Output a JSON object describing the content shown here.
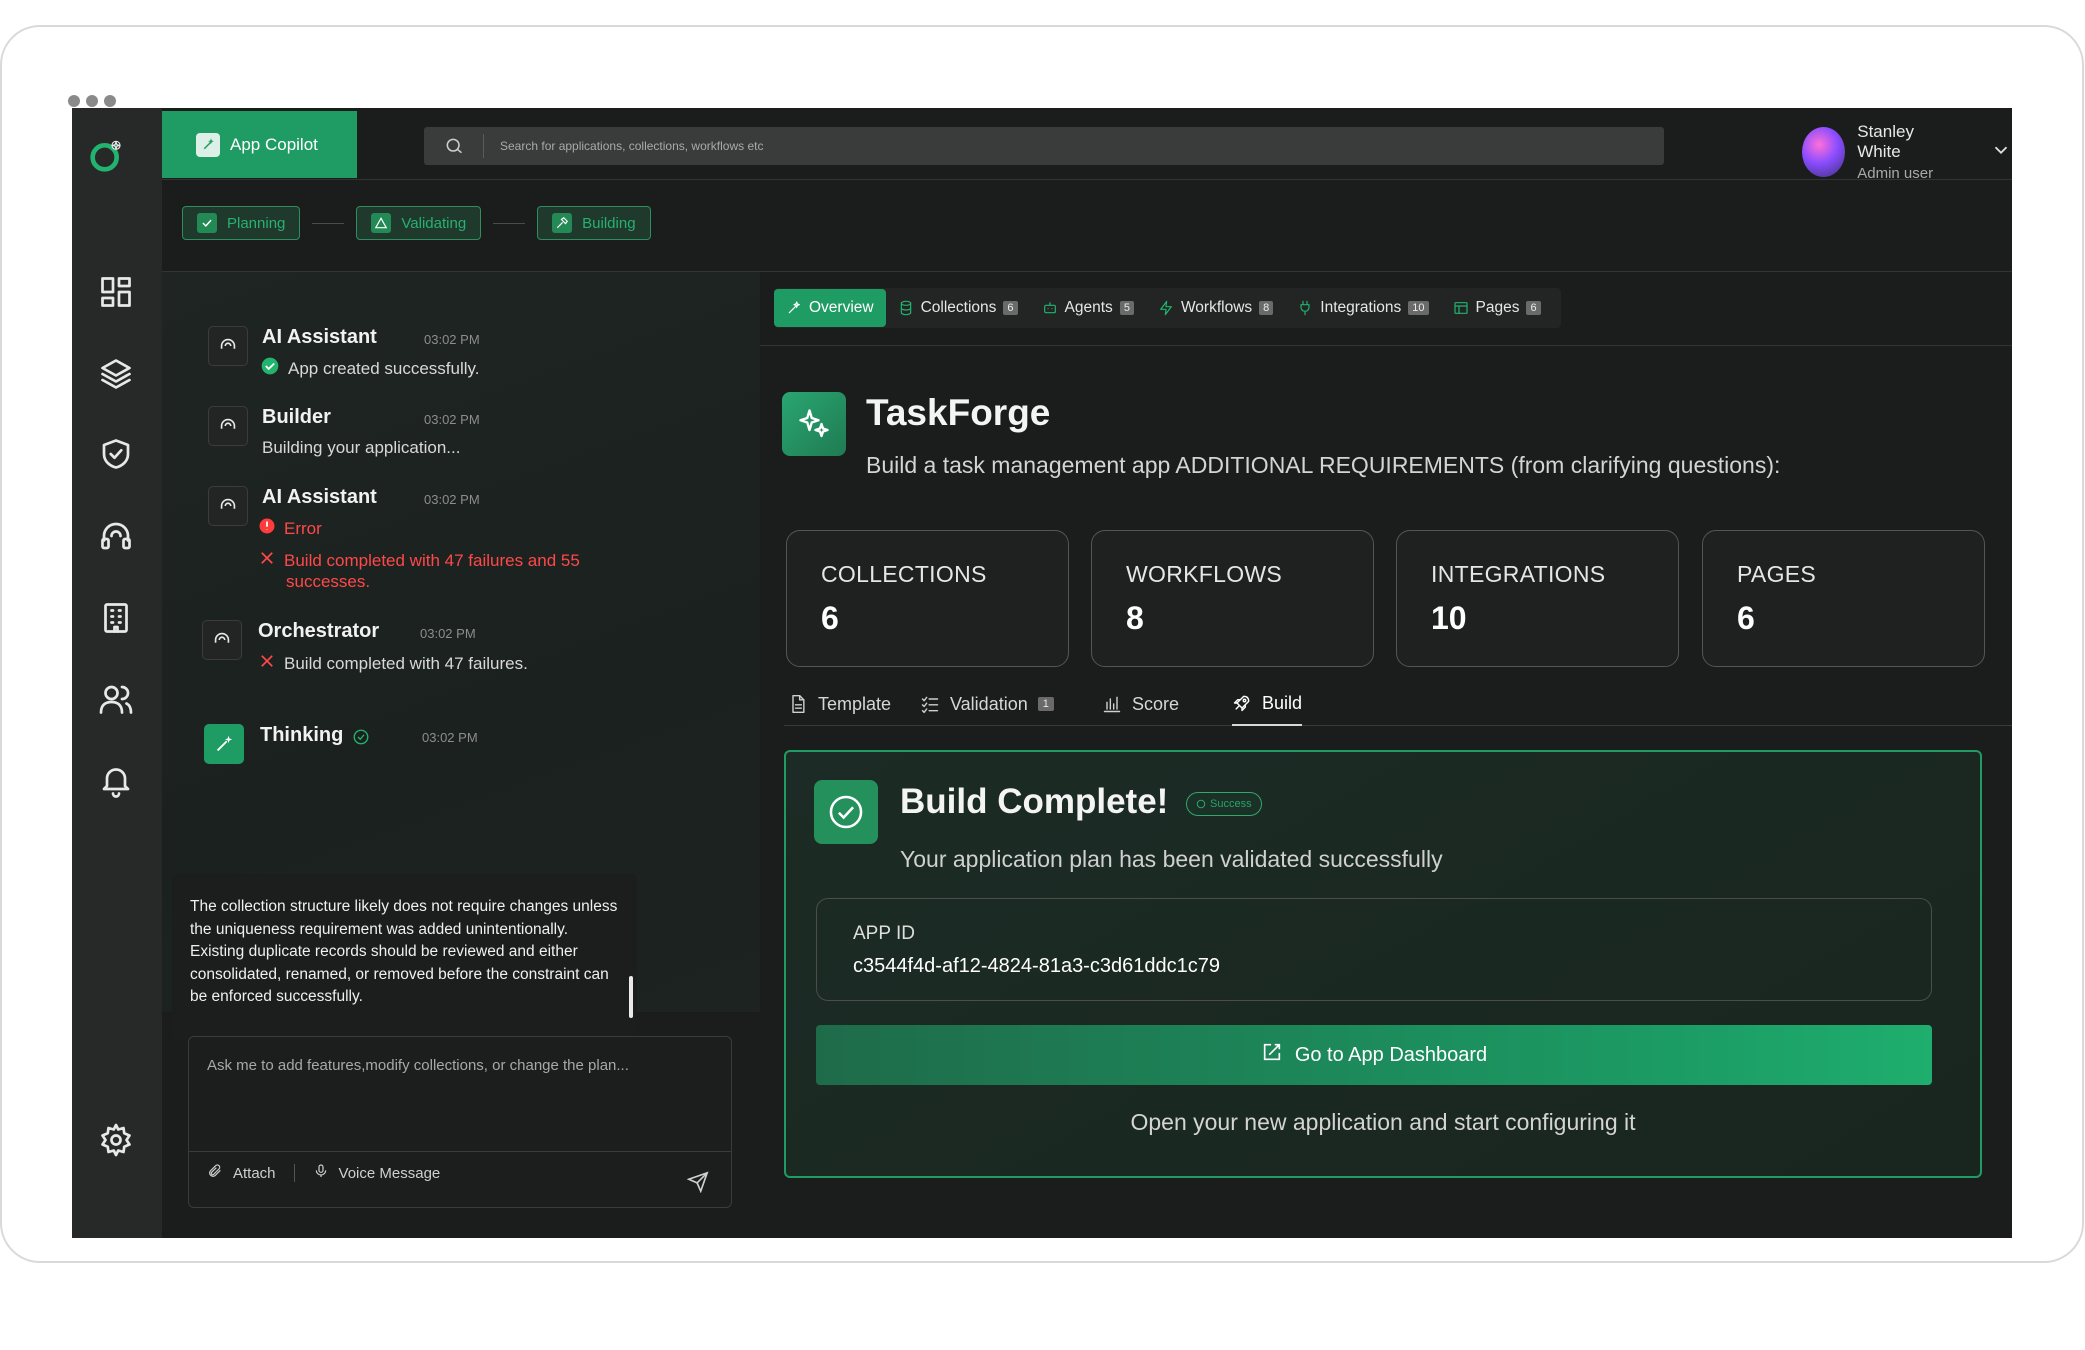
{
  "colors": {
    "accent": "#1f9c63",
    "error": "#ff4848",
    "background": "#1b1c1c",
    "rail": "#272828"
  },
  "topbar": {
    "copilot_label": "App Copilot",
    "search_placeholder": "Search for applications, collections, workflows etc",
    "user_name": "Stanley White",
    "user_role": "Admin user"
  },
  "stepper": [
    {
      "label": "Planning",
      "icon": "check-icon"
    },
    {
      "label": "Validating",
      "icon": "warning-icon"
    },
    {
      "label": "Building",
      "icon": "hammer-icon"
    }
  ],
  "rail": [
    "dashboard-icon",
    "layers-icon",
    "shield-check-icon",
    "headset-icon",
    "building-icon",
    "users-icon",
    "bell-icon",
    "settings-icon"
  ],
  "chat": {
    "messages": [
      {
        "name": "AI Assistant",
        "time": "03:02 PM",
        "text": "App created successfully."
      },
      {
        "name": "Builder",
        "time": "03:02 PM",
        "text": "Building your application..."
      },
      {
        "name": "AI Assistant",
        "time": "03:02 PM",
        "status": "Error",
        "text_line1": "Build completed with 47 failures and 55",
        "text_line2": "successes."
      },
      {
        "name": "Orchestrator",
        "time": "03:02 PM",
        "text": "Build completed with 47 failures."
      },
      {
        "name": "Thinking",
        "time": "03:02 PM",
        "text": "The collection structure likely does not require changes unless the uniqueness requirement was added unintentionally. Existing duplicate records should be reviewed and either consolidated, renamed, or removed before the constraint can be enforced successfully."
      }
    ],
    "composer_placeholder": "Ask me to add features,modify collections, or change the plan...",
    "attach_label": "Attach",
    "voice_label": "Voice Message"
  },
  "main": {
    "tabs": [
      {
        "label": "Overview",
        "count": null,
        "icon": "sparkle-icon"
      },
      {
        "label": "Collections",
        "count": "6",
        "icon": "database-icon"
      },
      {
        "label": "Agents",
        "count": "5",
        "icon": "robot-icon"
      },
      {
        "label": "Workflows",
        "count": "8",
        "icon": "bolt-icon"
      },
      {
        "label": "Integrations",
        "count": "10",
        "icon": "plug-icon"
      },
      {
        "label": "Pages",
        "count": "6",
        "icon": "layout-icon"
      }
    ],
    "app_title": "TaskForge",
    "app_description": "Build a task management app ADDITIONAL REQUIREMENTS (from clarifying questions):",
    "stats": [
      {
        "label": "COLLECTIONS",
        "value": "6"
      },
      {
        "label": "WORKFLOWS",
        "value": "8"
      },
      {
        "label": "INTEGRATIONS",
        "value": "10"
      },
      {
        "label": "PAGES",
        "value": "6"
      }
    ],
    "subtabs": [
      {
        "label": "Template",
        "count": null
      },
      {
        "label": "Validation",
        "count": "1"
      },
      {
        "label": "Score",
        "count": null
      },
      {
        "label": "Build",
        "count": null
      }
    ],
    "build": {
      "title": "Build Complete!",
      "badge": "Success",
      "subtitle": "Your application plan has been validated successfully",
      "app_id_label": "APP ID",
      "app_id_value": "c3544f4d-af12-4824-81a3-c3d61ddc1c79",
      "dashboard_button": "Go to App Dashboard",
      "footer": "Open your new application and start configuring it"
    }
  }
}
